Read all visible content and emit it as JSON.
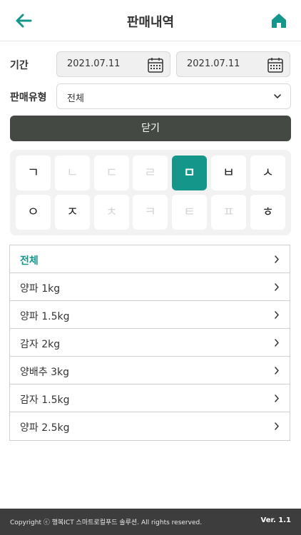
{
  "header": {
    "title": "판매내역",
    "back_icon": "arrow-left-icon",
    "home_icon": "home-icon",
    "accent": "#15968b"
  },
  "filters": {
    "period_label": "기간",
    "start_date": "2021.07.11",
    "end_date": "2021.07.11",
    "type_label": "판매유형",
    "type_value": "전체"
  },
  "close_button": "닫기",
  "keypad": {
    "row1": [
      "ㄱ",
      "ㄴ",
      "ㄷ",
      "ㄹ",
      "ㅁ",
      "ㅂ",
      "ㅅ"
    ],
    "row2": [
      "ㅇ",
      "ㅈ",
      "ㅊ",
      "ㅋ",
      "ㅌ",
      "ㅍ",
      "ㅎ"
    ],
    "active": "ㅁ",
    "disabled": [
      "ㄴ",
      "ㄷ",
      "ㄹ",
      "ㅊ",
      "ㅋ",
      "ㅌ",
      "ㅍ"
    ]
  },
  "list": {
    "items": [
      "전체",
      "양파 1kg",
      "양파 1.5kg",
      "감자 2kg",
      "양배추 3kg",
      "감자 1.5kg",
      "양파 2.5kg"
    ],
    "selected": "전체"
  },
  "footer": {
    "copyright": "Copyright ⓒ 행복ICT 스마트로컬푸드 솔루션. All rights reserved.",
    "version": "Ver. 1.1"
  }
}
